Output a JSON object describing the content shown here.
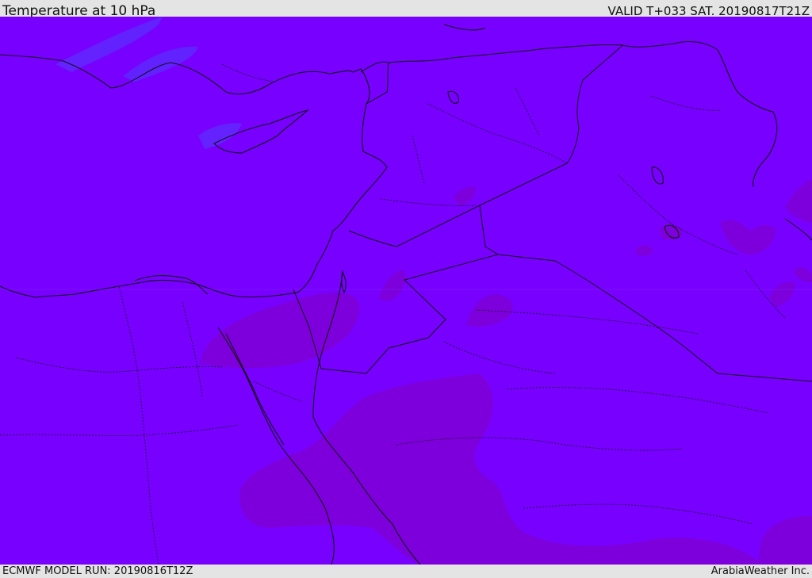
{
  "header": {
    "title": "Temperature at 10 hPa",
    "valid": "VALID T+033 SAT. 20190817T21Z"
  },
  "footer": {
    "model_run": "ECMWF MODEL RUN: 20190816T12Z",
    "credit": "ArabiaWeather Inc."
  },
  "colors": {
    "field_base": "#7800ff",
    "field_warm": "#7c00e2",
    "field_cool": "#5c2cff",
    "coastline": "#111111",
    "bars": "#e4e4e4"
  },
  "map_features": [
    "temperature-field",
    "coastlines",
    "country-borders",
    "province-borders"
  ]
}
